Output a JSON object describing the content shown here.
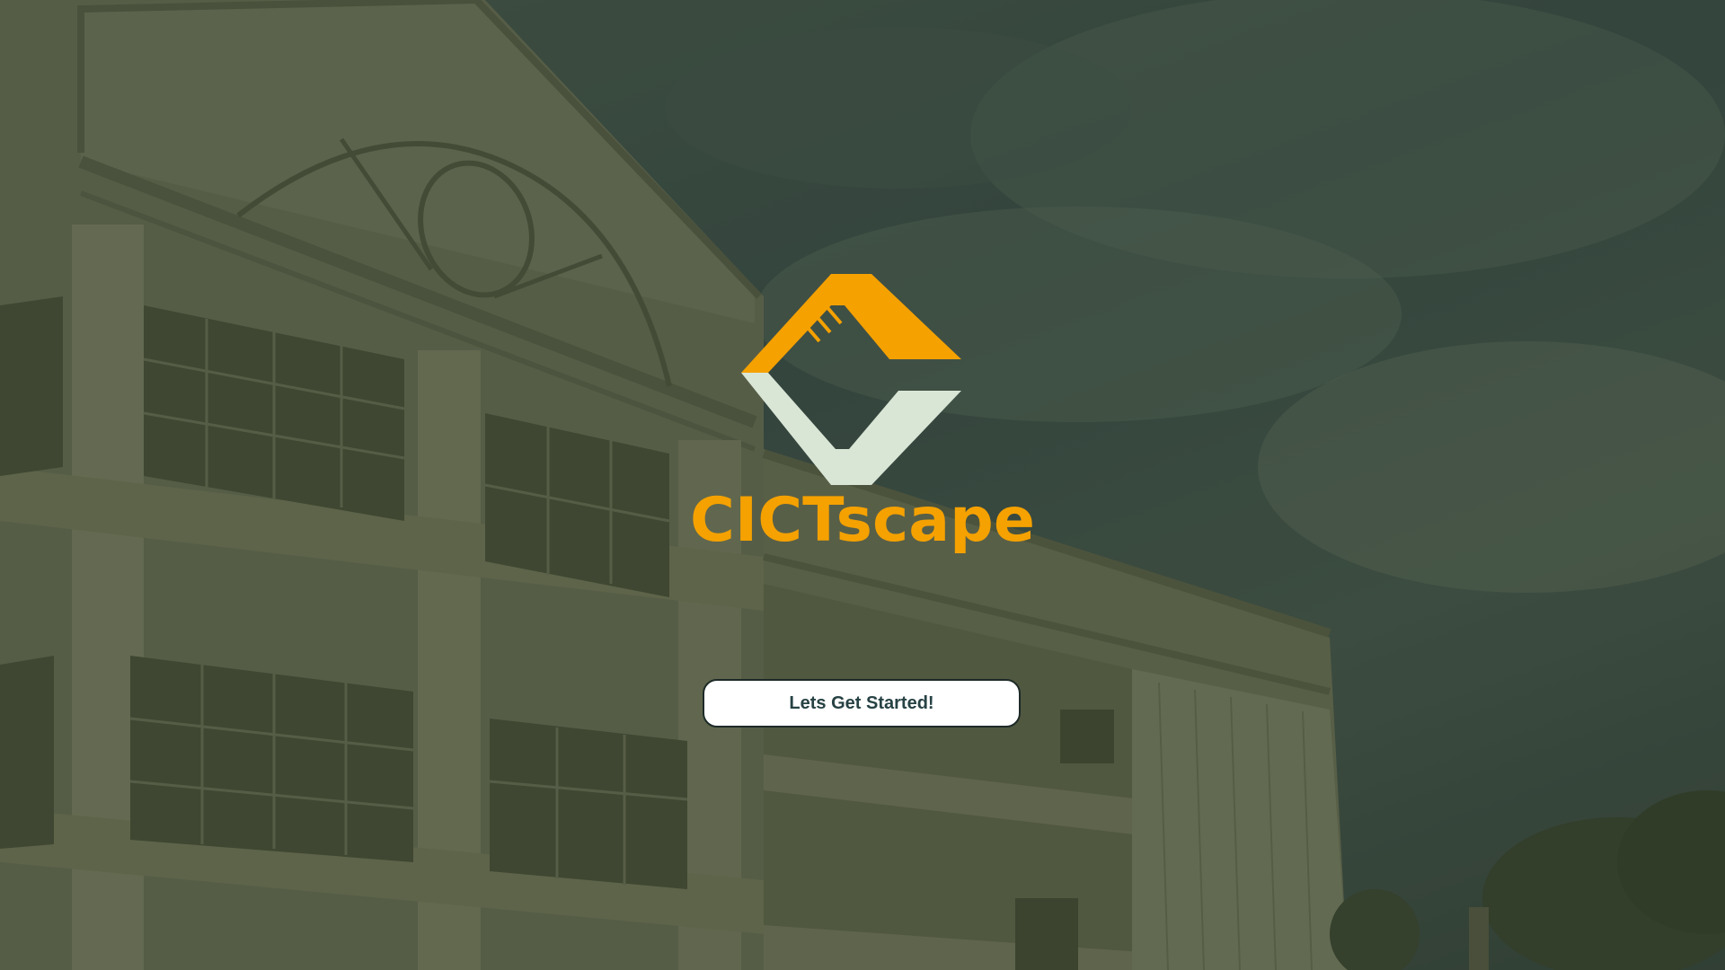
{
  "brand": {
    "name": "CICTscape",
    "logo_icon": "cictscape-logo-icon",
    "color_primary": "#f5a100",
    "color_secondary": "#d9e6d6"
  },
  "cta": {
    "label": "Lets Get Started!"
  },
  "background": {
    "image": "campus-building-photo",
    "overlay_color": "#3a4a3c"
  }
}
